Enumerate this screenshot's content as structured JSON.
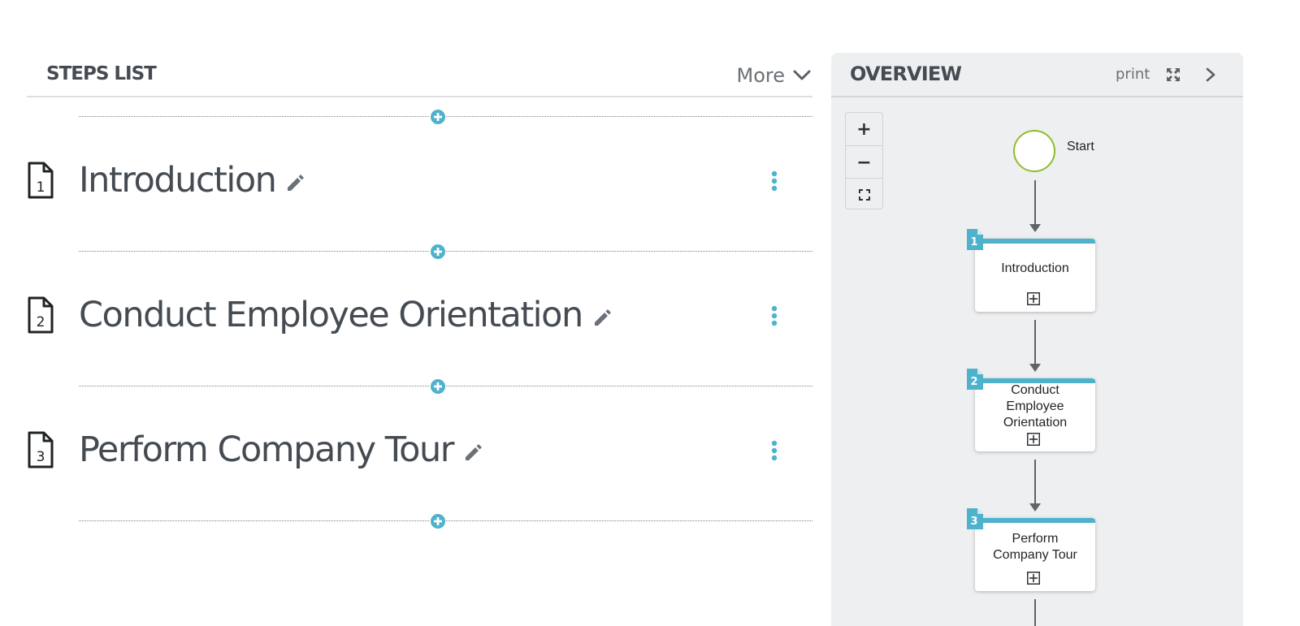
{
  "steps_list": {
    "title": "STEPS LIST",
    "more_label": "More",
    "steps": [
      {
        "number": "1",
        "name": "Introduction"
      },
      {
        "number": "2",
        "name": "Conduct Employee Orientation"
      },
      {
        "number": "3",
        "name": "Perform Company Tour"
      }
    ]
  },
  "overview": {
    "title": "OVERVIEW",
    "print_label": "print",
    "zoom_in": "+",
    "zoom_out": "−",
    "start_label": "Start",
    "nodes": [
      {
        "number": "1",
        "label": "Introduction"
      },
      {
        "number": "2",
        "label": "Conduct Employee Orientation"
      },
      {
        "number": "3",
        "label": "Perform Company Tour"
      }
    ]
  },
  "colors": {
    "accent": "#4eb2cc",
    "start_ring": "#8dbd2b",
    "text": "#454b52"
  },
  "icons": [
    "chevron-down-icon",
    "add-circle-icon",
    "document-number-icon",
    "pencil-icon",
    "kebab-menu-icon",
    "expand-icon",
    "chevron-right-icon",
    "fit-screen-icon",
    "expand-box-icon"
  ]
}
